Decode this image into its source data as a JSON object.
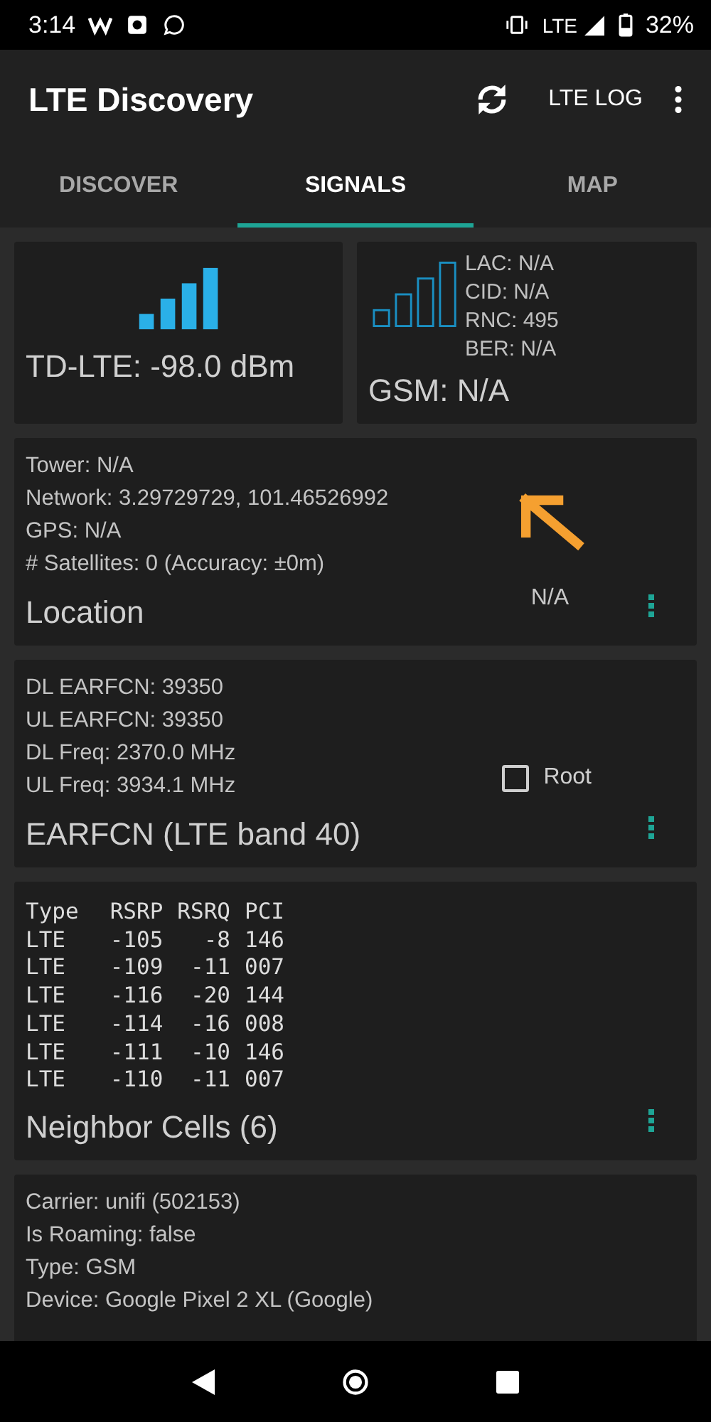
{
  "status_bar": {
    "time": "3:14",
    "network": "LTE",
    "battery": "32%"
  },
  "app_bar": {
    "title": "LTE Discovery",
    "action": "LTE LOG"
  },
  "tabs": [
    {
      "label": "DISCOVER",
      "selected": false
    },
    {
      "label": "SIGNALS",
      "selected": true
    },
    {
      "label": "MAP",
      "selected": false
    }
  ],
  "lte_card": {
    "reading": "TD-LTE: -98.0 dBm"
  },
  "gsm_card": {
    "details": [
      "LAC: N/A",
      "CID: N/A",
      "RNC: 495",
      "BER: N/A"
    ],
    "reading": "GSM: N/A"
  },
  "location_card": {
    "lines": [
      "Tower: N/A",
      "Network: 3.29729729, 101.46526992",
      "GPS: N/A",
      "# Satellites: 0 (Accuracy: ±0m)"
    ],
    "title": "Location",
    "bearing": "N/A"
  },
  "earfcn_card": {
    "lines": [
      "DL EARFCN: 39350",
      "UL EARFCN: 39350",
      "DL Freq: 2370.0 MHz",
      "UL Freq: 3934.1 MHz"
    ],
    "title": "EARFCN (LTE band 40)",
    "root": {
      "label": "Root",
      "checked": false
    }
  },
  "neighbor_card": {
    "columns": [
      "Type",
      "RSRP",
      "RSRQ",
      "PCI"
    ],
    "rows": [
      [
        "LTE",
        "-105",
        "-8",
        "146"
      ],
      [
        "LTE",
        "-109",
        "-11",
        "007"
      ],
      [
        "LTE",
        "-116",
        "-20",
        "144"
      ],
      [
        "LTE",
        "-114",
        "-16",
        "008"
      ],
      [
        "LTE",
        "-111",
        "-10",
        "146"
      ],
      [
        "LTE",
        "-110",
        "-11",
        "007"
      ]
    ],
    "title": "Neighbor Cells (6)"
  },
  "info_card": {
    "lines": [
      "Carrier: unifi (502153)",
      "Is Roaming: false",
      "Type: GSM",
      "Device: Google Pixel 2 XL (Google)"
    ]
  }
}
